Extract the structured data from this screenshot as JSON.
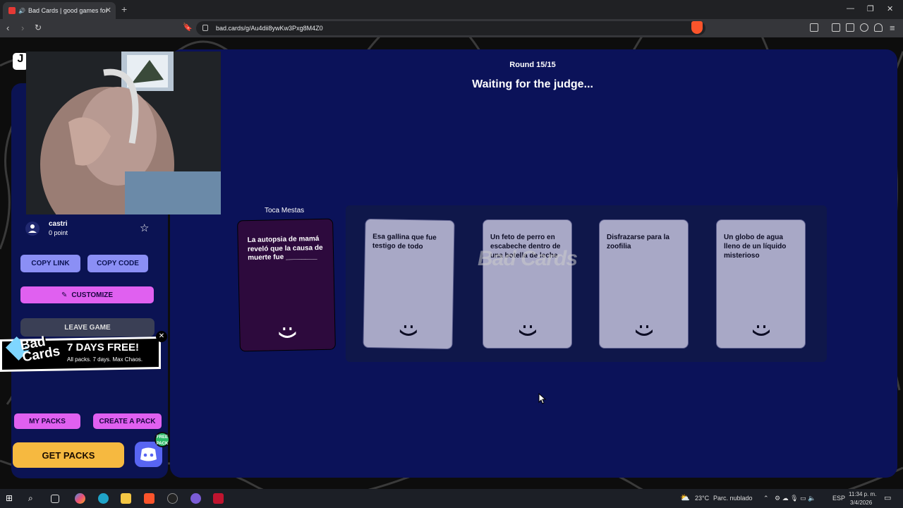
{
  "browser": {
    "tab_title": "Bad Cards | good games for",
    "url": "bad.cards/g/Au4dii8ywKw3Pxg8M4Z0"
  },
  "sidebar": {
    "player": {
      "name": "castri",
      "points": "0 point"
    },
    "copy_link": "COPY LINK",
    "copy_code": "COPY CODE",
    "customize": "CUSTOMIZE",
    "leave_game": "LEAVE GAME",
    "promo": {
      "logo": "Bad Cards",
      "title": "7 DAYS FREE!",
      "subtitle": "All packs. 7 days. Max Chaos."
    },
    "my_packs": "MY PACKS",
    "create_pack": "CREATE A PACK",
    "get_packs": "GET PACKS",
    "discord_badge": "FREE PACK"
  },
  "game": {
    "round": "Round 15/15",
    "status": "Waiting for the judge...",
    "judge_name": "Toca Mestas",
    "prompt": "La autopsia de mamá reveló que la causa de muerte fue ________",
    "answers": [
      "Esa gallina que fue testigo de todo",
      "Un feto de perro en escabeche dentro de una botella de leche",
      "Disfrazarse para la zoofilia",
      "Un globo de agua lleno de un líquido misterioso"
    ],
    "watermark": "Bad Cards"
  },
  "taskbar": {
    "weather": "23°C",
    "weather_desc": "Parc. nublado",
    "lang": "ESP",
    "time": "11:34 p. m.",
    "date": "3/4/2026"
  }
}
